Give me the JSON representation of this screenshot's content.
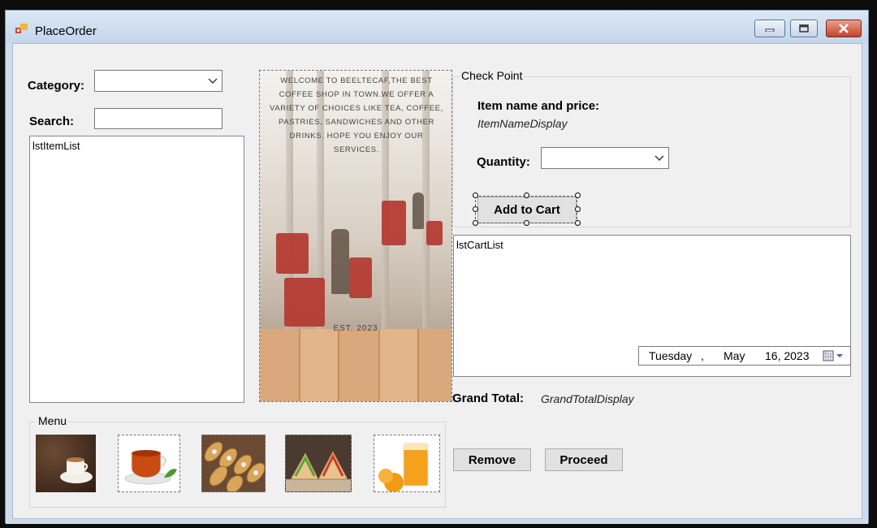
{
  "window": {
    "title": "PlaceOrder"
  },
  "form": {
    "category_label": "Category:",
    "category_value": "",
    "search_label": "Search:",
    "search_value": "",
    "item_list_text": "lstItemList",
    "welcome_text": "WELCOME TO BEELTECAF,THE BEST COFFEE SHOP IN TOWN.WE OFFER A VARIETY OF CHOICES LIKE TEA, COFFEE, PASTRIES, SANDWICHES AND OTHER DRINKS. HOPE YOU ENJOY OUR SERVICES.",
    "est_text": "EST. 2023"
  },
  "checkpoint": {
    "legend": "Check Point",
    "item_label": "Item name and price:",
    "item_display": "ItemNameDisplay",
    "quantity_label": "Quantity:",
    "quantity_value": "",
    "add_button": "Add to Cart"
  },
  "cart": {
    "list_text": "lstCartList",
    "date": {
      "day": "Tuesday",
      "sep": ",",
      "month": "May",
      "daynum_year": "16, 2023"
    }
  },
  "totals": {
    "label": "Grand Total:",
    "display": "GrandTotalDisplay"
  },
  "actions": {
    "remove": "Remove",
    "proceed": "Proceed"
  },
  "menu": {
    "legend": "Menu",
    "items": [
      {
        "icon": "coffee-icon"
      },
      {
        "icon": "tea-icon"
      },
      {
        "icon": "pastries-icon"
      },
      {
        "icon": "sandwich-icon"
      },
      {
        "icon": "juice-icon"
      }
    ]
  },
  "colors": {
    "window_frame": "#cfdcec",
    "client_bg": "#f0f0f0",
    "close_button": "#c3432b"
  }
}
